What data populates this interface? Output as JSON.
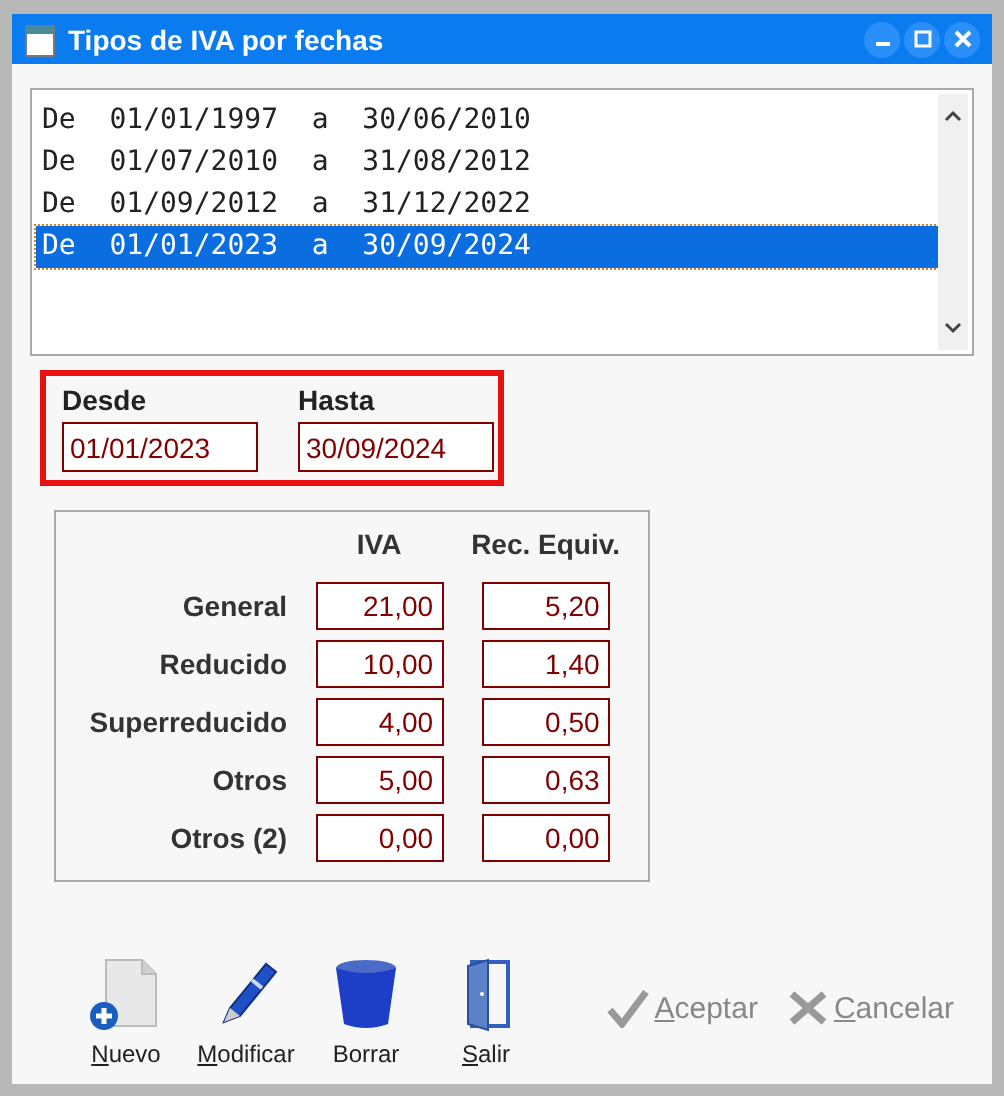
{
  "window": {
    "title": "Tipos de IVA por fechas"
  },
  "periods": [
    {
      "prefix": "De",
      "from": "01/01/1997",
      "sep": "a",
      "to": "30/06/2010",
      "selected": false
    },
    {
      "prefix": "De",
      "from": "01/07/2010",
      "sep": "a",
      "to": "31/08/2012",
      "selected": false
    },
    {
      "prefix": "De",
      "from": "01/09/2012",
      "sep": "a",
      "to": "31/12/2022",
      "selected": false
    },
    {
      "prefix": "De",
      "from": "01/01/2023",
      "sep": "a",
      "to": "30/09/2024",
      "selected": true
    }
  ],
  "range": {
    "from_label": "Desde",
    "from_value": "01/01/2023",
    "to_label": "Hasta",
    "to_value": "30/09/2024"
  },
  "rates": {
    "columns": [
      "IVA",
      "Rec. Equiv."
    ],
    "rows": [
      {
        "label": "General",
        "iva": "21,00",
        "rec": "5,20"
      },
      {
        "label": "Reducido",
        "iva": "10,00",
        "rec": "1,40"
      },
      {
        "label": "Superreducido",
        "iva": "4,00",
        "rec": "0,50"
      },
      {
        "label": "Otros",
        "iva": "5,00",
        "rec": "0,63"
      },
      {
        "label": "Otros (2)",
        "iva": "0,00",
        "rec": "0,00"
      }
    ]
  },
  "toolbar": [
    {
      "kind": "new",
      "label": "Nuevo",
      "underlined_first": true
    },
    {
      "kind": "edit",
      "label": "Modificar",
      "underlined_first": true
    },
    {
      "kind": "delete",
      "label": "Borrar",
      "underlined_first": false
    },
    {
      "kind": "exit",
      "label": "Salir",
      "underlined_first": true
    }
  ],
  "actions": [
    {
      "kind": "accept",
      "label": "Aceptar",
      "underlined_first": true,
      "disabled": true
    },
    {
      "kind": "cancel",
      "label": "Cancelar",
      "underlined_first": true,
      "disabled": true
    }
  ]
}
